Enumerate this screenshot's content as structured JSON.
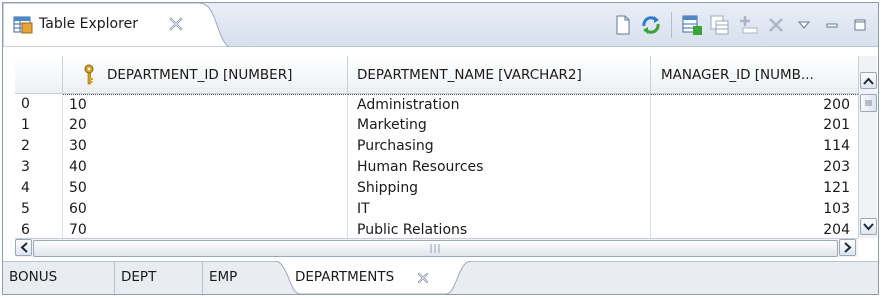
{
  "view": {
    "title": "Table Explorer",
    "close_label": "Close"
  },
  "toolbar": {
    "icons": [
      "new-icon",
      "refresh-icon",
      "table-properties-icon",
      "copy-table-icon",
      "add-row-icon",
      "delete-icon",
      "view-menu-icon",
      "minimize-icon",
      "maximize-icon"
    ]
  },
  "table": {
    "columns": [
      "",
      "DEPARTMENT_ID [NUMBER]",
      "DEPARTMENT_NAME [VARCHAR2]",
      "MANAGER_ID [NUMB..."
    ],
    "rows": [
      {
        "index": "0",
        "id": "10",
        "name": "Administration",
        "manager": "200"
      },
      {
        "index": "1",
        "id": "20",
        "name": "Marketing",
        "manager": "201"
      },
      {
        "index": "2",
        "id": "30",
        "name": "Purchasing",
        "manager": "114"
      },
      {
        "index": "3",
        "id": "40",
        "name": "Human Resources",
        "manager": "203"
      },
      {
        "index": "4",
        "id": "50",
        "name": "Shipping",
        "manager": "121"
      },
      {
        "index": "5",
        "id": "60",
        "name": "IT",
        "manager": "103"
      },
      {
        "index": "6",
        "id": "70",
        "name": "Public Relations",
        "manager": "204"
      }
    ]
  },
  "bottom_tabs": [
    {
      "label": "BONUS",
      "active": false
    },
    {
      "label": "DEPT",
      "active": false
    },
    {
      "label": "EMP",
      "active": false
    },
    {
      "label": "DEPARTMENTS",
      "active": true
    }
  ],
  "colors": {
    "header_bg": "#dde5f0",
    "accent": "#3a6ea5"
  }
}
